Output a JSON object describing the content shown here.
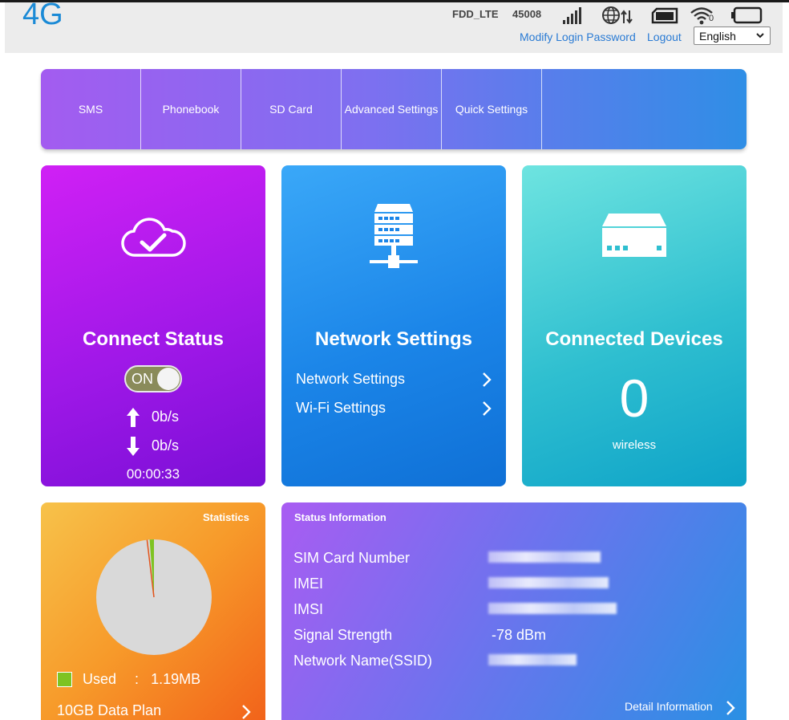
{
  "header": {
    "logo": "4G",
    "network_type": "FDD_LTE",
    "network_code": "45008",
    "links": {
      "modify_password": "Modify Login Password",
      "logout": "Logout"
    },
    "language": "English",
    "icons": [
      "signal-bars-icon",
      "globe-data-icon",
      "sim-card-icon",
      "wifi-icon",
      "battery-icon"
    ],
    "wifi_clients": "0"
  },
  "nav": {
    "items": [
      "SMS",
      "Phonebook",
      "SD Card",
      "Advanced Settings",
      "Quick Settings"
    ]
  },
  "connect_status": {
    "title": "Connect Status",
    "toggle_label": "ON",
    "toggle_on": true,
    "upload_rate": "0b/s",
    "download_rate": "0b/s",
    "duration": "00:00:33"
  },
  "network_settings": {
    "title": "Network Settings",
    "links": [
      "Network Settings",
      "Wi-Fi Settings"
    ]
  },
  "connected_devices": {
    "title": "Connected Devices",
    "count": "0",
    "type_label": "wireless"
  },
  "statistics": {
    "title": "Statistics",
    "used_label": "Used",
    "separator": ":",
    "used_value": "1.19MB",
    "plan": "10GB Data Plan",
    "used_fraction": 0.012,
    "colors": {
      "used": "#7ec322",
      "pie": "#d9d9d9",
      "line": "#e3531b"
    }
  },
  "status_info": {
    "title": "Status Information",
    "rows": [
      {
        "label": "SIM Card Number",
        "value": ""
      },
      {
        "label": "IMEI",
        "value": ""
      },
      {
        "label": "IMSI",
        "value": ""
      },
      {
        "label": "Signal Strength",
        "value": "-78 dBm"
      },
      {
        "label": "Network Name(SSID)",
        "value": ""
      }
    ],
    "detail_link": "Detail Information"
  }
}
